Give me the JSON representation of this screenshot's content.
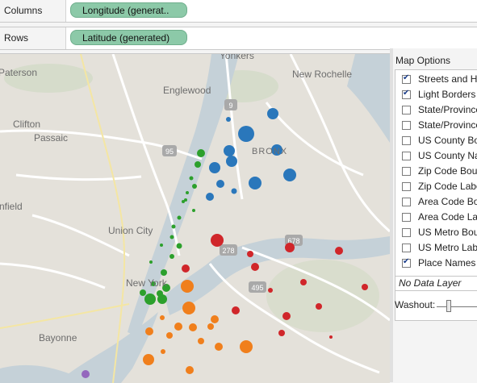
{
  "shelves": {
    "columns": {
      "label": "Columns",
      "pill": "Longitude (generat.."
    },
    "rows": {
      "label": "Rows",
      "pill": "Latitude (generated)"
    }
  },
  "map": {
    "place_labels": [
      {
        "text": "Yonkers",
        "name": "label-yonkers"
      },
      {
        "text": "Paterson",
        "name": "label-paterson"
      },
      {
        "text": "New Rochelle",
        "name": "label-new-rochelle"
      },
      {
        "text": "Englewood",
        "name": "label-englewood"
      },
      {
        "text": "Clifton",
        "name": "label-clifton"
      },
      {
        "text": "Passaic",
        "name": "label-passaic"
      },
      {
        "text": "BRONX",
        "name": "label-bronx"
      },
      {
        "text": "nfield",
        "name": "label-nfield"
      },
      {
        "text": "Union City",
        "name": "label-union-city"
      },
      {
        "text": "New York",
        "name": "label-new-york"
      },
      {
        "text": "Bayonne",
        "name": "label-bayonne"
      }
    ],
    "road_shields": [
      "9",
      "95",
      "278",
      "678",
      "495"
    ],
    "colors": {
      "blue": "#2a77bb",
      "green": "#2ca02c",
      "red": "#d0262a",
      "orange": "#f07f1c",
      "purple": "#9467bd",
      "water": "#c5d1d8",
      "land": "#e4e1da"
    }
  },
  "map_options": {
    "title": "Map Options",
    "items": [
      {
        "label": "Streets and Hi",
        "checked": true
      },
      {
        "label": "Light Borders",
        "checked": true
      },
      {
        "label": "State/Province",
        "checked": false
      },
      {
        "label": "State/Province",
        "checked": false
      },
      {
        "label": "US County Bo",
        "checked": false
      },
      {
        "label": "US County Na",
        "checked": false
      },
      {
        "label": "Zip Code Bour",
        "checked": false
      },
      {
        "label": "Zip Code Labe",
        "checked": false
      },
      {
        "label": "Area Code Bo",
        "checked": false
      },
      {
        "label": "Area Code Lab",
        "checked": false
      },
      {
        "label": "US Metro Bou",
        "checked": false
      },
      {
        "label": "US Metro Labe",
        "checked": false
      },
      {
        "label": "Place Names",
        "checked": true
      }
    ],
    "data_layer": "No Data Layer",
    "washout_label": "Washout:",
    "washout_level": 0.25
  }
}
